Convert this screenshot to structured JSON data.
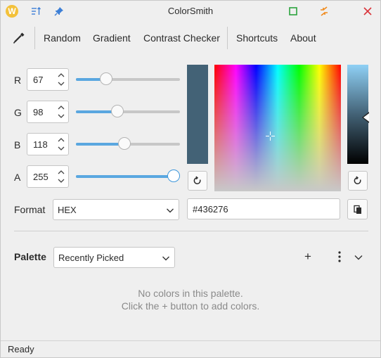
{
  "window": {
    "title": "ColorSmith",
    "logo_letter": "W"
  },
  "toolbar": {
    "random": "Random",
    "gradient": "Gradient",
    "contrast": "Contrast Checker",
    "shortcuts": "Shortcuts",
    "about": "About"
  },
  "channels": {
    "r": {
      "label": "R",
      "value": "67",
      "fraction": 0.263
    },
    "g": {
      "label": "G",
      "value": "98",
      "fraction": 0.384
    },
    "b": {
      "label": "B",
      "value": "118",
      "fraction": 0.463
    },
    "a": {
      "label": "A",
      "value": "255",
      "fraction": 1.0
    }
  },
  "current_color": "#436276",
  "format": {
    "label": "Format",
    "selected": "HEX",
    "hex_value": "#436276"
  },
  "palette": {
    "label": "Palette",
    "selected": "Recently Picked",
    "add_symbol": "+",
    "empty_line1": "No colors in this palette.",
    "empty_line2": "Click the + button to add colors."
  },
  "status": {
    "text": "Ready"
  },
  "colors": {
    "accent": "#5aa7e0",
    "pin": "#3d7fd6",
    "maximize": "#2aa33c",
    "swap": "#f08a1c",
    "close": "#d9343a"
  }
}
